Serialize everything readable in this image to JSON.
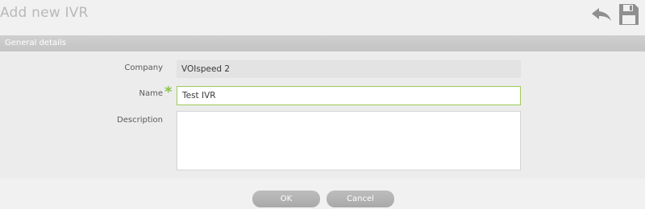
{
  "page": {
    "title": "Add new IVR"
  },
  "toolbar": {
    "back_icon": "undo-arrow-icon",
    "save_icon": "floppy-disk-icon"
  },
  "section": {
    "title": "General details"
  },
  "form": {
    "company": {
      "label": "Company",
      "value": "VOIspeed 2"
    },
    "name": {
      "label": "Name",
      "value": "Test IVR",
      "required_mark": "*"
    },
    "description": {
      "label": "Description",
      "value": ""
    }
  },
  "buttons": {
    "ok": "OK",
    "cancel": "Cancel"
  },
  "colors": {
    "required": "#8bc34a",
    "input_focus_border": "#9ccc58",
    "button": "#b3b3b3"
  }
}
